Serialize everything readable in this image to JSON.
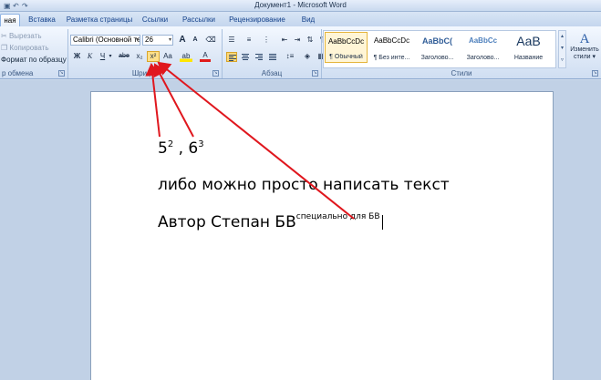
{
  "window": {
    "title": "Документ1 - Microsoft Word"
  },
  "quick_access": {
    "save_icon": "save-icon",
    "undo_icon": "undo-icon",
    "redo_icon": "redo-icon"
  },
  "tabs": [
    {
      "label": "ная",
      "active": true
    },
    {
      "label": "Вставка"
    },
    {
      "label": "Разметка страницы"
    },
    {
      "label": "Ссылки"
    },
    {
      "label": "Рассылки"
    },
    {
      "label": "Рецензирование"
    },
    {
      "label": "Вид"
    }
  ],
  "clipboard": {
    "cut": "Вырезать",
    "copy": "Копировать",
    "format_painter": "Формат по образцу",
    "group_label": "р обмена"
  },
  "font": {
    "font_name": "Calibri (Основной те",
    "font_size": "26",
    "grow": "A",
    "shrink": "A",
    "bold": "Ж",
    "italic": "К",
    "underline": "Ч",
    "strike": "abe",
    "subscript": "x₂",
    "superscript": "x²",
    "change_case": "Aa",
    "highlight": "ab",
    "font_color": "A",
    "group_label": "Шрифт"
  },
  "paragraph": {
    "group_label": "Абзац"
  },
  "styles": {
    "group_label": "Стили",
    "tiles": [
      {
        "sample": "AaBbCcDc",
        "name": "¶ Обычный",
        "active": true
      },
      {
        "sample": "AaBbCcDc",
        "name": "¶ Без инте..."
      },
      {
        "sample": "AaBbC(",
        "name": "Заголово..."
      },
      {
        "sample": "AaBbCc",
        "name": "Заголово..."
      },
      {
        "sample": "AaB",
        "name": "Название"
      }
    ],
    "change_styles_line1": "Изменить",
    "change_styles_line2": "стили ▾"
  },
  "document": {
    "line1_a": "5",
    "line1_a_sup": "2",
    "line1_sep": " , ",
    "line1_b": "6",
    "line1_b_sup": "3",
    "line2": "либо можно просто написать текст",
    "line3": "Автор Степан БВ",
    "line3_sup": "специально для БВ"
  },
  "annotation": {
    "arrow_color": "#e0171e"
  }
}
